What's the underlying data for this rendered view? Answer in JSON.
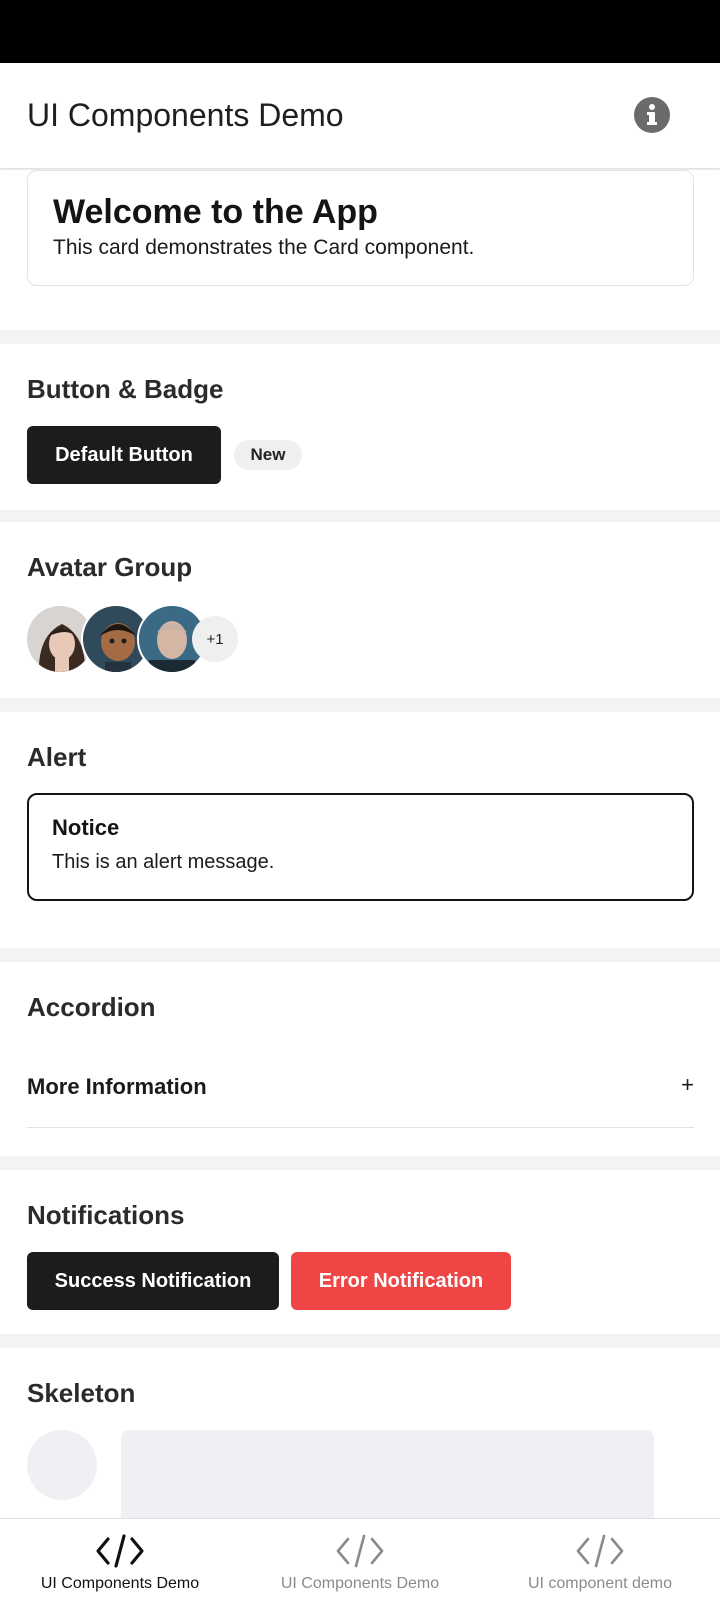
{
  "header": {
    "title": "UI Components Demo",
    "info_icon": "info-icon"
  },
  "welcome_card": {
    "title": "Welcome to the App",
    "description": "This card demonstrates the Card component."
  },
  "button_badge": {
    "heading": "Button & Badge",
    "button_label": "Default Button",
    "badge_label": "New"
  },
  "avatar_group": {
    "heading": "Avatar Group",
    "avatars": [
      "avatar-woman",
      "avatar-child",
      "avatar-man"
    ],
    "more_label": "+1"
  },
  "alert": {
    "heading": "Alert",
    "title": "Notice",
    "message": "This is an alert message."
  },
  "accordion": {
    "heading": "Accordion",
    "item_label": "More Information",
    "expand_symbol": "+"
  },
  "notifications": {
    "heading": "Notifications",
    "success_label": "Success Notification",
    "error_label": "Error Notification",
    "error_color": "#ef4545"
  },
  "skeleton": {
    "heading": "Skeleton"
  },
  "bottom_nav": {
    "items": [
      {
        "label": "UI Components Demo",
        "icon": "code-icon",
        "active": true
      },
      {
        "label": "UI Components Demo",
        "icon": "code-icon",
        "active": false
      },
      {
        "label": "UI component demo",
        "icon": "code-icon",
        "active": false
      }
    ]
  }
}
